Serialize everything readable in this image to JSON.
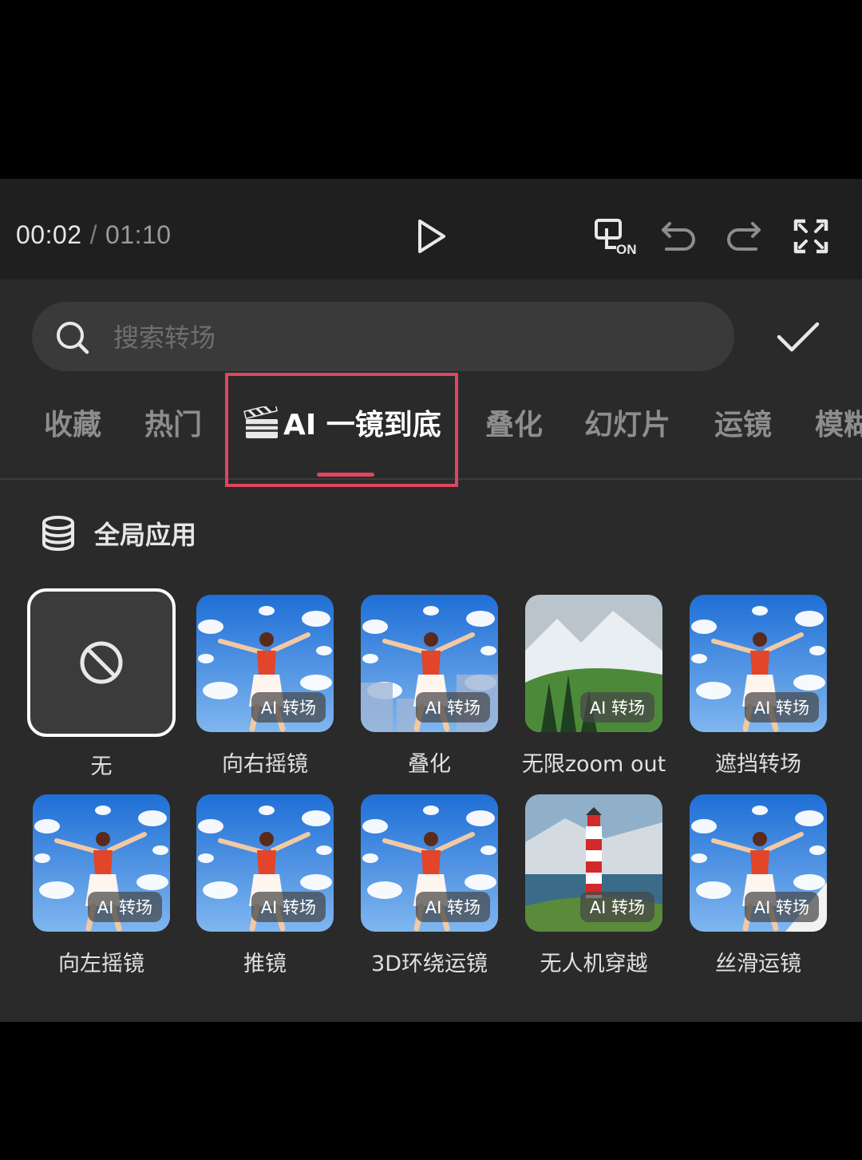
{
  "player": {
    "current_time": "00:02",
    "separator": "/",
    "total_time": "01:10"
  },
  "search": {
    "placeholder": "搜索转场"
  },
  "tabs": [
    {
      "label": "收藏"
    },
    {
      "label": "热门"
    },
    {
      "label": "AI 一镜到底",
      "active": true
    },
    {
      "label": "叠化"
    },
    {
      "label": "幻灯片"
    },
    {
      "label": "运镜"
    },
    {
      "label": "模糊"
    }
  ],
  "global_apply": {
    "label": "全局应用"
  },
  "transitions": [
    {
      "label": "无",
      "type": "none"
    },
    {
      "label": "向右摇镜",
      "badge": "AI 转场",
      "scene": "jumper"
    },
    {
      "label": "叠化",
      "badge": "AI 转场",
      "scene": "jumper-city"
    },
    {
      "label": "无限zoom out",
      "badge": "AI 转场",
      "scene": "mountain"
    },
    {
      "label": "遮挡转场",
      "badge": "AI 转场",
      "scene": "jumper"
    },
    {
      "label": "向左摇镜",
      "badge": "AI 转场",
      "scene": "jumper"
    },
    {
      "label": "推镜",
      "badge": "AI 转场",
      "scene": "jumper"
    },
    {
      "label": "3D环绕运镜",
      "badge": "AI 转场",
      "scene": "jumper"
    },
    {
      "label": "无人机穿越",
      "badge": "AI 转场",
      "scene": "lighthouse"
    },
    {
      "label": "丝滑运镜",
      "badge": "AI 转场",
      "scene": "jumper-wall"
    }
  ],
  "colors": {
    "accent": "#e0455f",
    "panel": "#2a2a2a",
    "player_bar": "#1f1f1f"
  }
}
